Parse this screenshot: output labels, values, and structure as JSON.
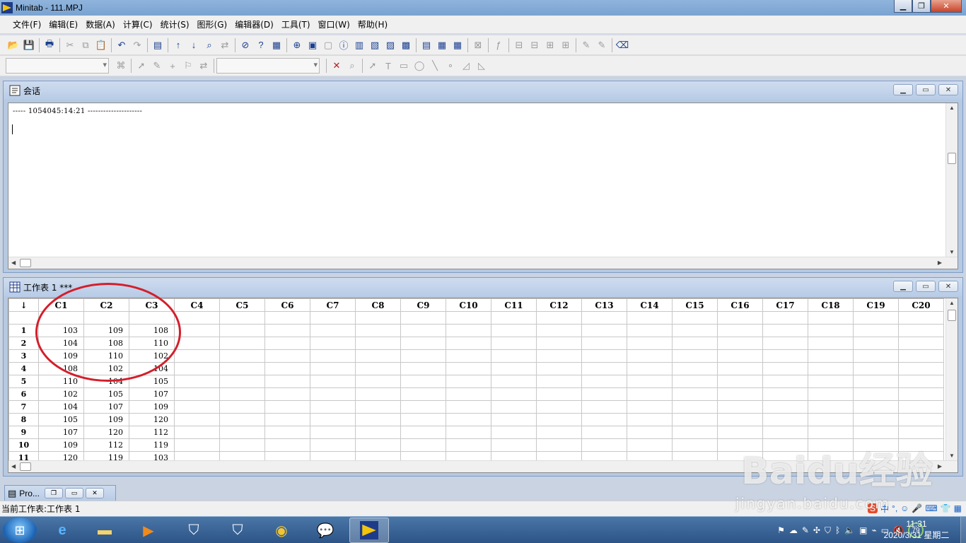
{
  "window": {
    "title": "Minitab - 111.MPJ",
    "minimize": "▁",
    "restore": "❐",
    "close": "✕"
  },
  "menu": [
    "文件(F)",
    "编辑(E)",
    "数据(A)",
    "计算(C)",
    "统计(S)",
    "图形(G)",
    "编辑器(D)",
    "工具(T)",
    "窗口(W)",
    "帮助(H)"
  ],
  "session": {
    "title": "会话",
    "line1": "-----    1054045:14:21    ---------------------"
  },
  "worksheet": {
    "title": "工作表 1 ***",
    "corner": "↓",
    "columns": [
      "C1",
      "C2",
      "C3",
      "C4",
      "C5",
      "C6",
      "C7",
      "C8",
      "C9",
      "C10",
      "C11",
      "C12",
      "C13",
      "C14",
      "C15",
      "C16",
      "C17",
      "C18",
      "C19",
      "C20"
    ],
    "rows": [
      {
        "n": "1",
        "c1": "103",
        "c2": "109",
        "c3": "108"
      },
      {
        "n": "2",
        "c1": "104",
        "c2": "108",
        "c3": "110"
      },
      {
        "n": "3",
        "c1": "109",
        "c2": "110",
        "c3": "102"
      },
      {
        "n": "4",
        "c1": "108",
        "c2": "102",
        "c3": "104"
      },
      {
        "n": "5",
        "c1": "110",
        "c2": "104",
        "c3": "105"
      },
      {
        "n": "6",
        "c1": "102",
        "c2": "105",
        "c3": "107"
      },
      {
        "n": "7",
        "c1": "104",
        "c2": "107",
        "c3": "109"
      },
      {
        "n": "8",
        "c1": "105",
        "c2": "109",
        "c3": "120"
      },
      {
        "n": "9",
        "c1": "107",
        "c2": "120",
        "c3": "112"
      },
      {
        "n": "10",
        "c1": "109",
        "c2": "112",
        "c3": "119"
      },
      {
        "n": "11",
        "c1": "120",
        "c2": "119",
        "c3": "103"
      }
    ]
  },
  "project_min": {
    "label": "Pro..."
  },
  "status": {
    "text": "当前工作表:工作表 1"
  },
  "taskbar": {
    "apps": [
      "internet-explorer-icon",
      "file-explorer-icon",
      "media-player-icon",
      "security-shield-icon",
      "security-shield-2-icon",
      "chrome-icon",
      "wechat-icon",
      "minitab-icon"
    ],
    "badge": "79",
    "time": "11:31",
    "date": "2020/3/31 星期二"
  },
  "watermark": {
    "text": "Baidu经验",
    "url": "jingyan.baidu.com"
  },
  "colors": {
    "title_bar": "#7aa3d1",
    "accent_red": "#d41f2b",
    "taskbar": "#2d5486"
  }
}
